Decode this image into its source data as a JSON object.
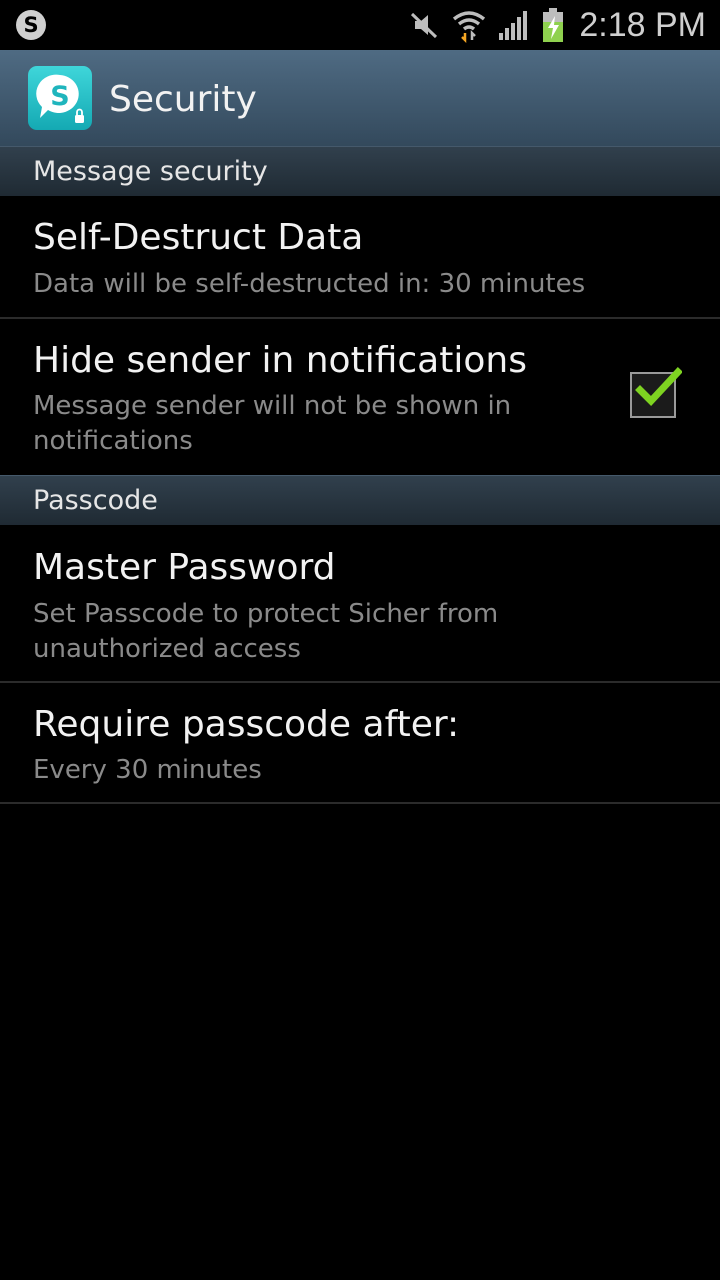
{
  "status_bar": {
    "time": "2:18 PM",
    "icons": [
      "skype-icon",
      "mute-icon",
      "wifi-icon",
      "signal-icon",
      "battery-charging-icon"
    ]
  },
  "action_bar": {
    "title": "Security",
    "app_icon": "app-logo-s-icon"
  },
  "sections": {
    "message_security": {
      "header": "Message security",
      "self_destruct": {
        "title": "Self-Destruct Data",
        "summary": "Data will be self-destructed in: 30 minutes"
      },
      "hide_sender": {
        "title": "Hide sender in notifications",
        "summary": "Message sender will not be shown in notifications",
        "checked": true
      }
    },
    "passcode": {
      "header": "Passcode",
      "master_password": {
        "title": "Master Password",
        "summary": "Set Passcode to protect Sicher from unauthorized access"
      },
      "require_passcode": {
        "title": "Require passcode after:",
        "summary": "Every 30 minutes"
      }
    }
  },
  "colors": {
    "action_bar": "#4f6b83",
    "section_header": "#2a3742",
    "check_green": "#7ed321",
    "app_icon_teal": "#1fc2c9"
  }
}
